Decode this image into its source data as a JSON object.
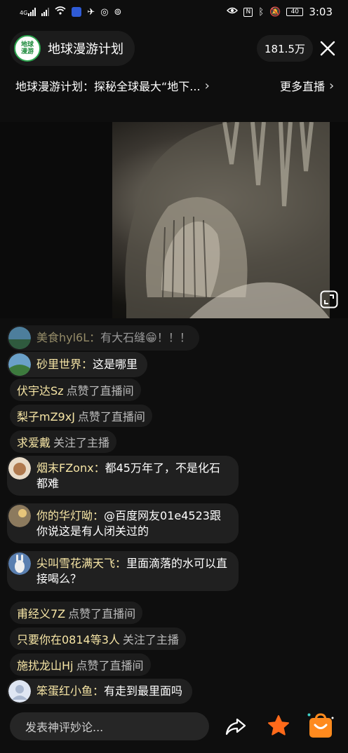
{
  "status_bar": {
    "signal1_label": "4G",
    "signal2_label": "",
    "battery": "40",
    "time": "3:03"
  },
  "header": {
    "avatar_text": "地球漫游",
    "host_name": "地球漫游计划",
    "viewers": "181.5万",
    "live_title": "地球漫游计划：探秘全球最大“地下...",
    "more_live": "更多直播"
  },
  "chat": [
    {
      "type": "comment",
      "user": "美食hyl6L：",
      "text": "有大石缝😁！！！"
    },
    {
      "type": "comment",
      "user": "砂里世界：",
      "text": "这是哪里"
    },
    {
      "type": "notice",
      "user": "伏宇达Sz",
      "action": "点赞了直播间"
    },
    {
      "type": "notice",
      "user": "梨子mZ9xJ",
      "action": "点赞了直播间"
    },
    {
      "type": "notice",
      "user": "求爱戴",
      "action": "关注了主播"
    },
    {
      "type": "comment",
      "user": "烟末FZonx：",
      "text": "都45万年了，不是化石都难"
    },
    {
      "type": "comment",
      "user": "你的华灯呦：",
      "text": "@百度网友01e4523跟你说这是有人闭关过的"
    },
    {
      "type": "comment",
      "user": "尖叫雪花满天飞：",
      "text": "里面滴落的水可以直接喝么？"
    },
    {
      "type": "notice",
      "user": "甫经义7Z",
      "action": "点赞了直播间"
    },
    {
      "type": "notice",
      "user": "只要你在0814等3人",
      "action": "关注了主播"
    },
    {
      "type": "notice",
      "user": "施扰龙山Hj",
      "action": "点赞了直播间"
    },
    {
      "type": "comment",
      "user": "笨蛋红小鱼：",
      "text": "有走到最里面吗"
    }
  ],
  "bottom": {
    "input_placeholder": "发表神评妙论..."
  },
  "colors": {
    "username": "#f7e6a6",
    "like_orange": "#ff6a1a",
    "shop_orange": "#ff8a1e"
  }
}
